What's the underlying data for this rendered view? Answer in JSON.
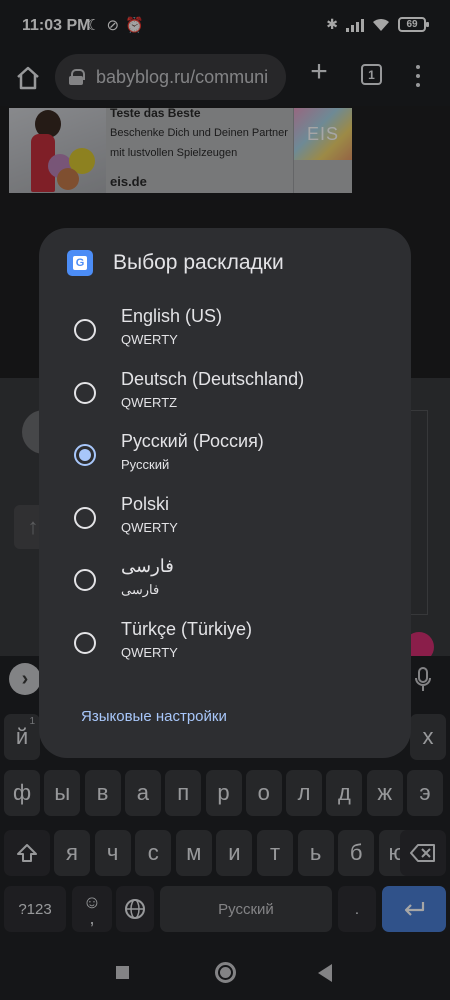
{
  "status": {
    "time": "11:03 PM",
    "battery": "69"
  },
  "browser": {
    "url": "babyblog.ru/communi",
    "tab_count": "1"
  },
  "ad": {
    "title": "Teste das Beste",
    "description": "Beschenke Dich und Deinen Partner mit lustvollen Spielzeugen",
    "domain": "eis.de",
    "logo_text": "EIS"
  },
  "dialog": {
    "title": "Выбор раскладки",
    "options": [
      {
        "label": "English (US)",
        "sub": "QWERTY",
        "selected": false
      },
      {
        "label": "Deutsch (Deutschland)",
        "sub": "QWERTZ",
        "selected": false
      },
      {
        "label": "Русский (Россия)",
        "sub": "Русский",
        "selected": true
      },
      {
        "label": "Polski",
        "sub": "QWERTY",
        "selected": false
      },
      {
        "label": "فارسی",
        "sub": "فارسی",
        "selected": false
      },
      {
        "label": "Türkçe (Türkiye)",
        "sub": "QWERTY",
        "selected": false
      }
    ],
    "settings_link": "Языковые настройки"
  },
  "keyboard": {
    "row1_left": "й",
    "row1_left_hint": "1",
    "row1_right": "х",
    "row2": [
      "ф",
      "ы",
      "в",
      "а",
      "п",
      "р",
      "о",
      "л",
      "д",
      "ж",
      "э"
    ],
    "row3": [
      "я",
      "ч",
      "с",
      "м",
      "и",
      "т",
      "ь",
      "б",
      "ю"
    ],
    "symbols_key": "?123",
    "emoji_key": "☺",
    "comma_key": ",",
    "space_label": "Русский",
    "period_key": "."
  },
  "colors": {
    "accent": "#a8c7fa",
    "enter_key": "#4a7fd4",
    "dialog_bg": "#2d2e31"
  }
}
